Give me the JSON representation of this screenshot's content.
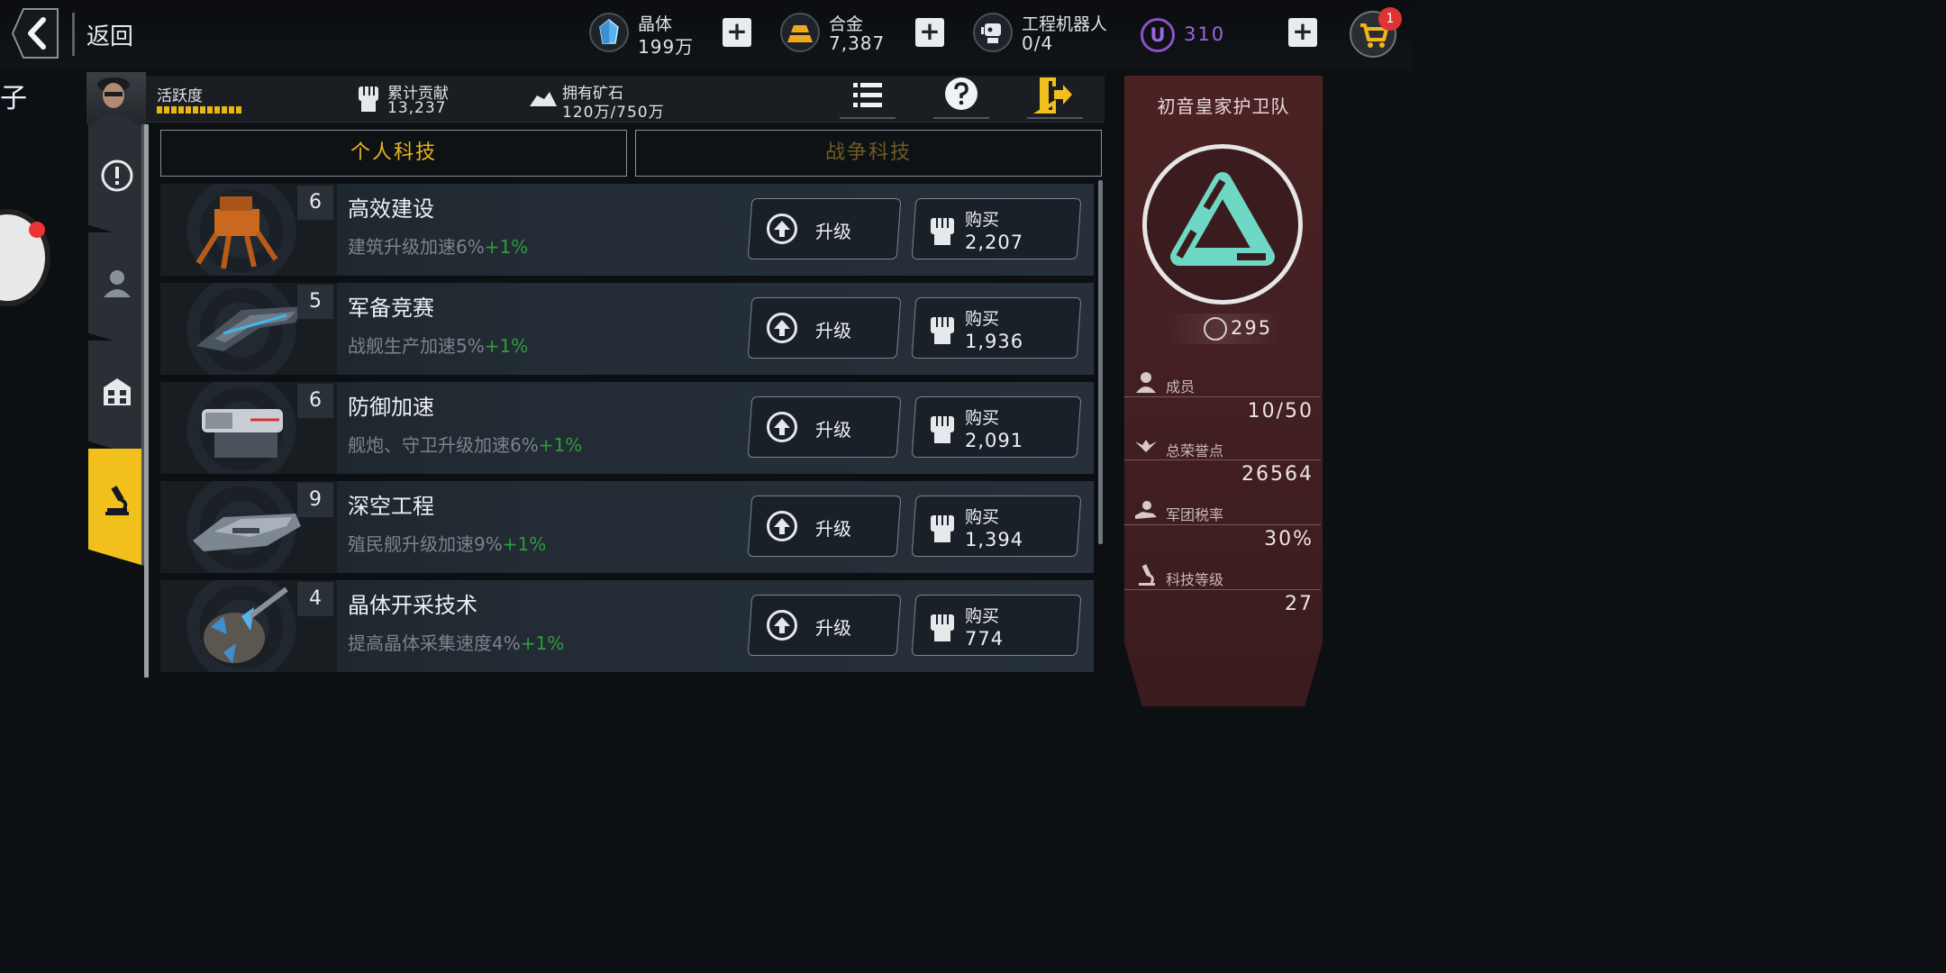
{
  "header": {
    "back_label": "返回",
    "resources": {
      "crystal": {
        "name": "晶体",
        "value": "199万"
      },
      "alloy": {
        "name": "合金",
        "value": "7,387"
      },
      "robot": {
        "name": "工程机器人",
        "value": "0/4"
      },
      "premium": {
        "symbol": "U",
        "value": "310"
      }
    },
    "plus_symbol": "+",
    "cart_badge": "1"
  },
  "left_peek": {
    "text": "子"
  },
  "stats": {
    "activity_label": "活跃度",
    "contribution": {
      "name": "累计贡献",
      "value": "13,237"
    },
    "ore": {
      "name": "拥有矿石",
      "value": "120万/750万"
    }
  },
  "tabs": {
    "personal": "个人科技",
    "war": "战争科技"
  },
  "tech_list": [
    {
      "level": "6",
      "title": "高效建设",
      "desc": "建筑升级加速6%",
      "bonus": "+1%",
      "upgrade": "升级",
      "buy": "购买",
      "price": "2,207"
    },
    {
      "level": "5",
      "title": "军备竞赛",
      "desc": "战舰生产加速5%",
      "bonus": "+1%",
      "upgrade": "升级",
      "buy": "购买",
      "price": "1,936"
    },
    {
      "level": "6",
      "title": "防御加速",
      "desc": "舰炮、守卫升级加速6%",
      "bonus": "+1%",
      "upgrade": "升级",
      "buy": "购买",
      "price": "2,091"
    },
    {
      "level": "9",
      "title": "深空工程",
      "desc": "殖民舰升级加速9%",
      "bonus": "+1%",
      "upgrade": "升级",
      "buy": "购买",
      "price": "1,394"
    },
    {
      "level": "4",
      "title": "晶体开采技术",
      "desc": "提高晶体采集速度4%",
      "bonus": "+1%",
      "upgrade": "升级",
      "buy": "购买",
      "price": "774"
    }
  ],
  "guild": {
    "name": "初音皇家护卫队",
    "score": "295",
    "members_label": "成员",
    "members_value": "10/50",
    "honor_label": "总荣誉点",
    "honor_value": "26564",
    "tax_label": "军团税率",
    "tax_value": "30%",
    "tech_label": "科技等级",
    "tech_value": "27"
  },
  "colors": {
    "accent": "#f2c01c",
    "bonus_green": "#2f9c3d",
    "premium_purple": "#8c52c9",
    "panel_red": "#4b2224",
    "emblem_teal": "#6fd8c4"
  }
}
